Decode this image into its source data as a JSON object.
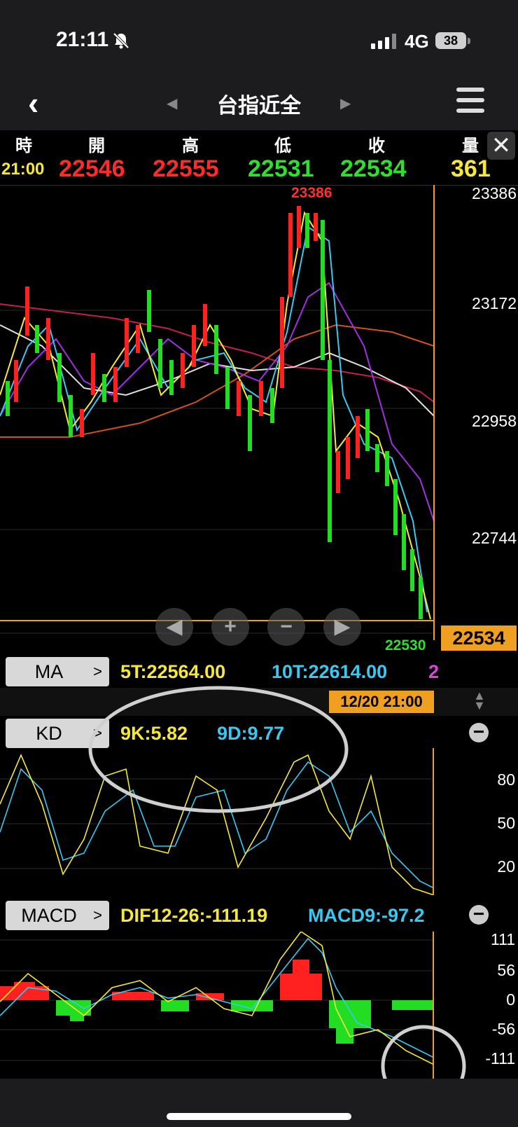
{
  "status": {
    "time": "21:11",
    "network": "4G",
    "battery": "38"
  },
  "nav": {
    "title": "台指近全"
  },
  "ohlc": {
    "headers": [
      "時",
      "開",
      "高",
      "低",
      "收",
      "量"
    ],
    "values": [
      "21:00",
      "22546",
      "22555",
      "22531",
      "22534",
      "361"
    ]
  },
  "price_axis": {
    "labels": [
      "23386",
      "23172",
      "22958",
      "22744"
    ],
    "current": "22534",
    "high_marker": "23386",
    "low_marker": "22530"
  },
  "ma": {
    "button": "MA",
    "t5": "5T:22564.00",
    "t10": "10T:22614.00",
    "t20": "2"
  },
  "cursor": {
    "date": "12/20 21:00"
  },
  "kd": {
    "button": "KD",
    "k": "9K:5.82",
    "d": "9D:9.77",
    "axis": [
      "80",
      "50",
      "20"
    ]
  },
  "macd": {
    "button": "MACD",
    "dif": "DIF12-26:-111.19",
    "macd9": "MACD9:-97.2",
    "axis": [
      "111",
      "56",
      "0",
      "-56",
      "-111"
    ]
  },
  "colors": {
    "up": "#ff2020",
    "down": "#22dd22",
    "cursor": "#f0a020",
    "k": "#f5e83a",
    "d": "#3ac8f0"
  }
}
